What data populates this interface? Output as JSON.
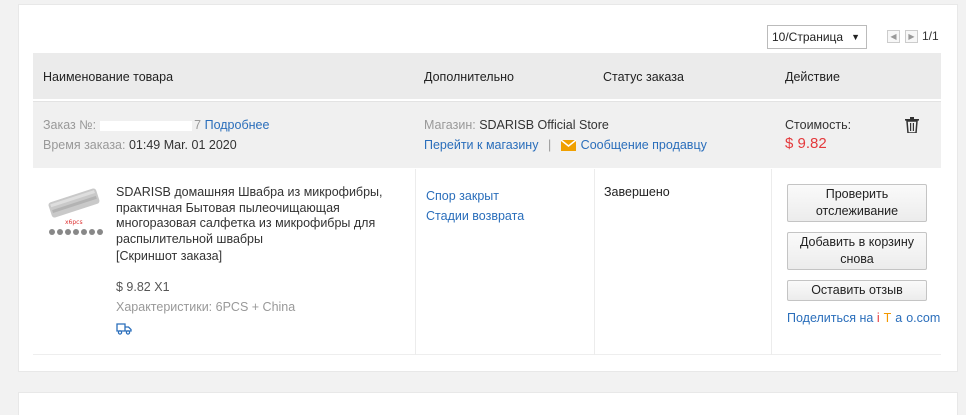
{
  "pagination": {
    "per_page": "10/Страница",
    "prev_icon": "triangle-left",
    "next_icon": "triangle-right",
    "page_count": "1/1"
  },
  "table_header": {
    "product": "Наименование товара",
    "extra": "Дополнительно",
    "status": "Статус заказа",
    "action": "Действие"
  },
  "order": {
    "number_label": "Заказ №:",
    "number_suffix": "7",
    "details_link": "Подробнее",
    "time_label": "Время заказа:",
    "time_value": "01:49 Mar. 01 2020",
    "store_label": "Магазин:",
    "store_name": "SDARISB Official Store",
    "goto_store": "Перейти к магазину",
    "separator": "|",
    "message_seller": "Сообщение продавцу",
    "cost_label": "Стоимость:",
    "cost_value": "$ 9.82",
    "delete_icon": "trash-icon"
  },
  "item": {
    "title_lines": [
      "SDARISB домашняя Швабра из микрофибры,",
      "практичная Бытовая пылеочищающая",
      "многоразовая салфетка из микрофибры для",
      "распылительной швабры"
    ],
    "snapshot": "[Скриншот заказа]",
    "price_qty": "$ 9.82 X1",
    "specs_label": "Характеристики:",
    "specs_value": "6PCS + China",
    "shipping_icon": "truck-icon",
    "dispute": "Спор закрыт",
    "return_stages": "Стадии возврата",
    "status": "Завершено",
    "btn_track": [
      "Проверить",
      "отслеживание"
    ],
    "btn_cart": [
      "Добавить в корзину",
      "снова"
    ],
    "btn_review": "Оставить отзыв",
    "share_prefix": "Поделиться на",
    "share_letters": [
      "i",
      "T",
      "a",
      "o",
      ".com"
    ],
    "share_colors": [
      "#e4393c",
      "#f39800",
      "#2a6ebb",
      "#2a6ebb",
      "#2a6ebb"
    ]
  }
}
